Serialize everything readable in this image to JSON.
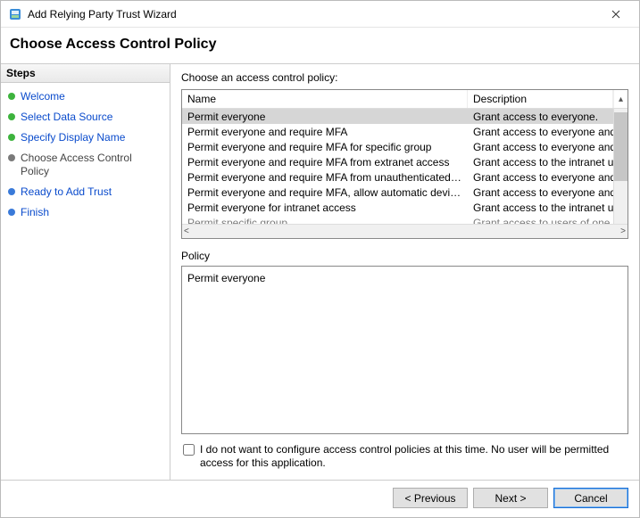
{
  "window": {
    "title": "Add Relying Party Trust Wizard"
  },
  "header": {
    "title": "Choose Access Control Policy"
  },
  "steps": {
    "heading": "Steps",
    "items": [
      {
        "label": "Welcome",
        "state": "done"
      },
      {
        "label": "Select Data Source",
        "state": "done"
      },
      {
        "label": "Specify Display Name",
        "state": "done"
      },
      {
        "label": "Choose Access Control Policy",
        "state": "current"
      },
      {
        "label": "Ready to Add Trust",
        "state": "todo"
      },
      {
        "label": "Finish",
        "state": "todo"
      }
    ]
  },
  "content": {
    "choose_label": "Choose an access control policy:",
    "columns": {
      "name": "Name",
      "desc": "Description"
    },
    "policies": [
      {
        "name": "Permit everyone",
        "desc": "Grant access to everyone.",
        "selected": true
      },
      {
        "name": "Permit everyone and require MFA",
        "desc": "Grant access to everyone and requir"
      },
      {
        "name": "Permit everyone and require MFA for specific group",
        "desc": "Grant access to everyone and requir"
      },
      {
        "name": "Permit everyone and require MFA from extranet access",
        "desc": "Grant access to the intranet users an"
      },
      {
        "name": "Permit everyone and require MFA from unauthenticated devices",
        "desc": "Grant access to everyone and requir"
      },
      {
        "name": "Permit everyone and require MFA, allow automatic device registr...",
        "desc": "Grant access to everyone and requir"
      },
      {
        "name": "Permit everyone for intranet access",
        "desc": "Grant access to the intranet users."
      },
      {
        "name": "Permit specific group",
        "desc": "Grant access to users of one or more",
        "dim": true
      }
    ],
    "policy_label": "Policy",
    "policy_text": "Permit everyone",
    "skip_checkbox_label": "I do not want to configure access control policies at this time. No user will be permitted access for this application.",
    "skip_checked": false
  },
  "footer": {
    "previous": "< Previous",
    "next": "Next >",
    "cancel": "Cancel"
  }
}
